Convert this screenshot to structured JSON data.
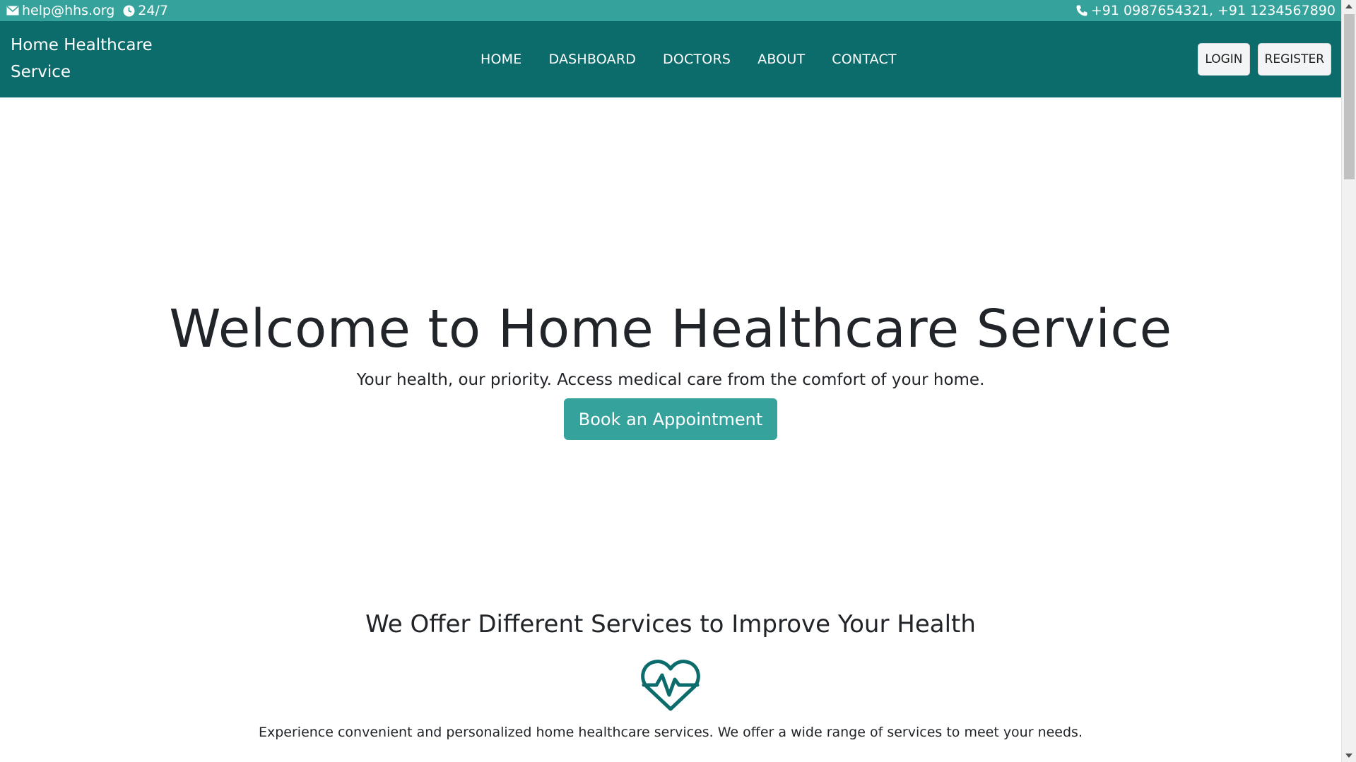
{
  "topbar": {
    "email": "help@hhs.org",
    "hours": "24/7",
    "phones": "+91 0987654321, +91 1234567890",
    "icons": [
      "envelope-icon",
      "clock-icon",
      "phone-icon"
    ]
  },
  "navbar": {
    "brand": "Home Healthcare Service",
    "links": [
      {
        "label": "HOME"
      },
      {
        "label": "DASHBOARD"
      },
      {
        "label": "DOCTORS"
      },
      {
        "label": "ABOUT"
      },
      {
        "label": "CONTACT"
      }
    ],
    "login_label": "LOGIN",
    "register_label": "REGISTER"
  },
  "hero": {
    "title": "Welcome to Home Healthcare Service",
    "subtitle": "Your health, our priority. Access medical care from the comfort of your home.",
    "cta_label": "Book an Appointment"
  },
  "services": {
    "heading": "We Offer Different Services to Improve Your Health",
    "icon": "heart-pulse-icon",
    "description": "Experience convenient and personalized home healthcare services. We offer a wide range of services to meet your needs."
  },
  "colors": {
    "topbar_bg": "#35a39c",
    "navbar_bg": "#0c6b6b",
    "accent": "#35a39c",
    "text": "#212529"
  }
}
